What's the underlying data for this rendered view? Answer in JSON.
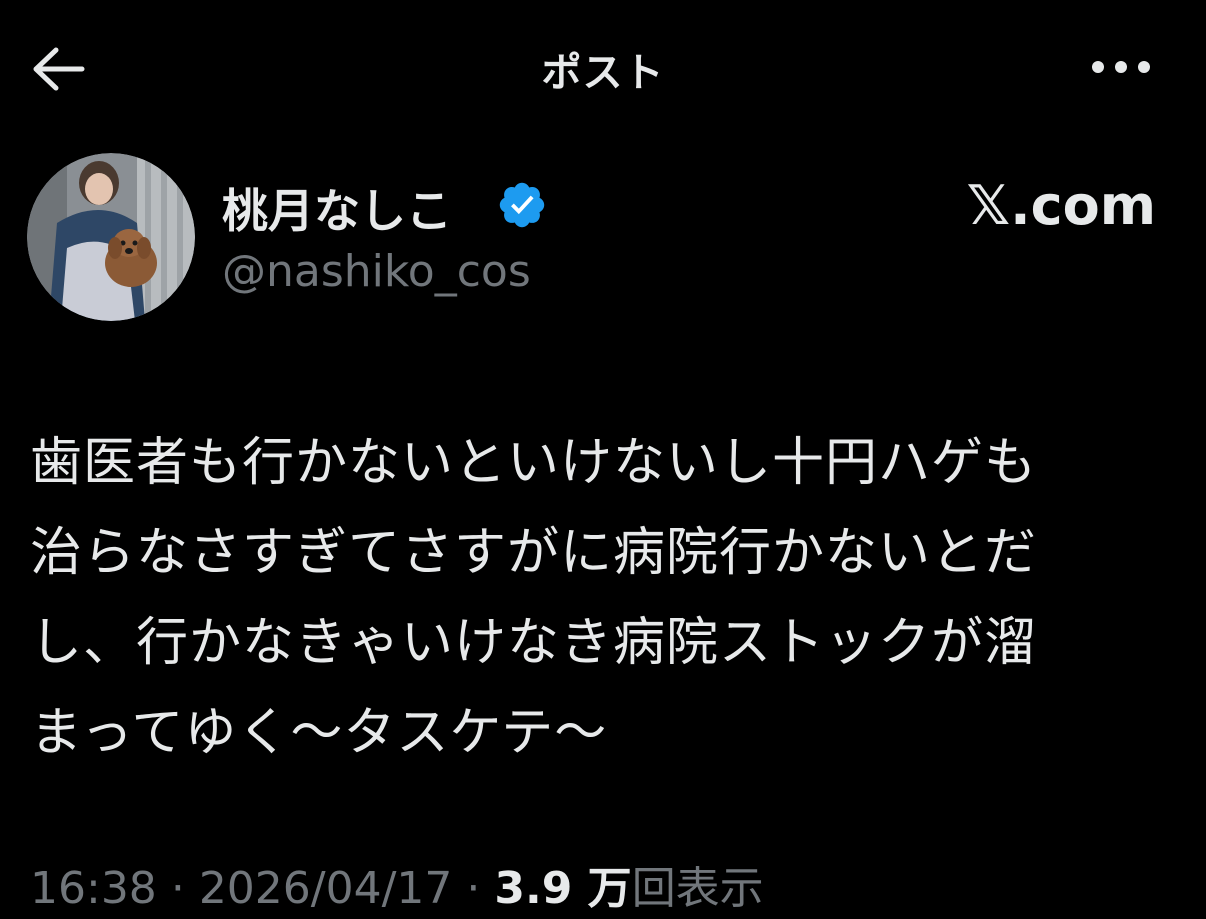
{
  "header": {
    "title": "ポスト",
    "back_icon": "arrow-left-icon",
    "more_icon": "more-horizontal-icon"
  },
  "author": {
    "display_name": "桃月なしこ",
    "handle": "@nashiko_cos",
    "verified": true,
    "verified_color": "#1d9bf0"
  },
  "watermark": "𝕏.com",
  "tweet": {
    "lines": [
      "歯医者も行かないといけないし十円ハゲも",
      "治らなさすぎてさすがに病院行かないとだ",
      "し、行かなきゃいけなき病院ストックが溜",
      "まってゆく〜タスケテ〜"
    ]
  },
  "meta": {
    "time": "16:38",
    "separator": "·",
    "date": "2026/04/17",
    "views_count": "3.9 万",
    "views_label": "回表示"
  },
  "colors": {
    "background": "#000000",
    "primary_text": "#e7e9ea",
    "secondary_text": "#71767b"
  }
}
